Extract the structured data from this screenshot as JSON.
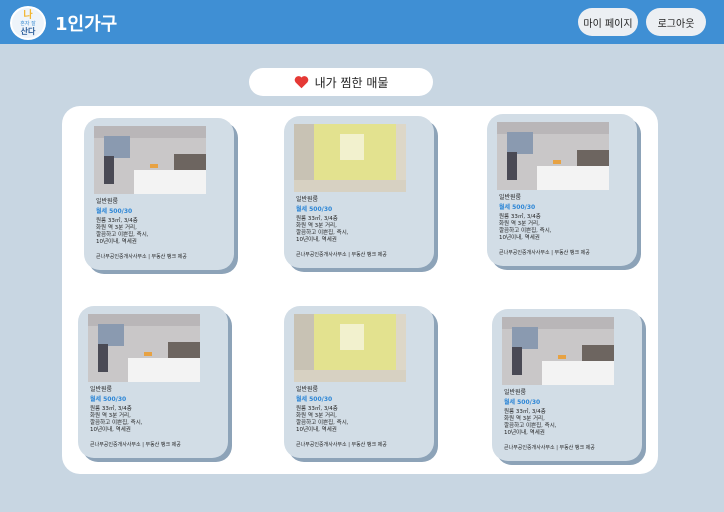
{
  "header": {
    "logo_line1": "나",
    "logo_line2": "혼자 잘",
    "logo_line3": "산다",
    "title": "1인가구",
    "mypage_label": "마이 페이지",
    "logout_label": "로그아웃"
  },
  "favorites": {
    "title": "내가 찜한 매물",
    "icon": "heart-icon",
    "heart_color": "#e53935"
  },
  "listings": [
    {
      "type": "일반원룸",
      "price": "월세 500/30",
      "desc": [
        "원룸 33㎡, 3/4층",
        "화원 역 3분 거리,",
        "깔끔하고 이쁜집, 즉시,",
        "10년이내, 역세권"
      ],
      "agency": "큰나무공인중개사사무소 | 부동산 뱅크 제공"
    },
    {
      "type": "일반원룸",
      "price": "월세 500/30",
      "desc": [
        "원룸 33㎡, 3/4층",
        "화원 역 3분 거리,",
        "깔끔하고 이쁜집, 즉시,",
        "10년이내, 역세권"
      ],
      "agency": "큰나무공인중개사사무소 | 부동산 뱅크 제공"
    },
    {
      "type": "일반원룸",
      "price": "월세 500/30",
      "desc": [
        "원룸 33㎡, 3/4층",
        "화원 역 3분 거리,",
        "깔끔하고 이쁜집, 즉시,",
        "10년이내, 역세권"
      ],
      "agency": "큰나무공인중개사사무소 | 부동산 뱅크 제공"
    },
    {
      "type": "일반원룸",
      "price": "월세 500/30",
      "desc": [
        "원룸 33㎡, 3/4층",
        "화원 역 3분 거리,",
        "깔끔하고 이쁜집, 즉시,",
        "10년이내, 역세권"
      ],
      "agency": "큰나무공인중개사사무소 | 부동산 뱅크 제공"
    },
    {
      "type": "일반원룸",
      "price": "월세 500/30",
      "desc": [
        "원룸 33㎡, 3/4층",
        "화원 역 3분 거리,",
        "깔끔하고 이쁜집, 즉시,",
        "10년이내, 역세권"
      ],
      "agency": "큰나무공인중개사사무소 | 부동산 뱅크 제공"
    },
    {
      "type": "일반원룸",
      "price": "월세 500/30",
      "desc": [
        "원룸 33㎡, 3/4층",
        "화원 역 3분 거리,",
        "깔끔하고 이쁜집, 즉시,",
        "10년이내, 역세권"
      ],
      "agency": "큰나무공인중개사사무소 | 부동산 뱅크 제공"
    }
  ]
}
